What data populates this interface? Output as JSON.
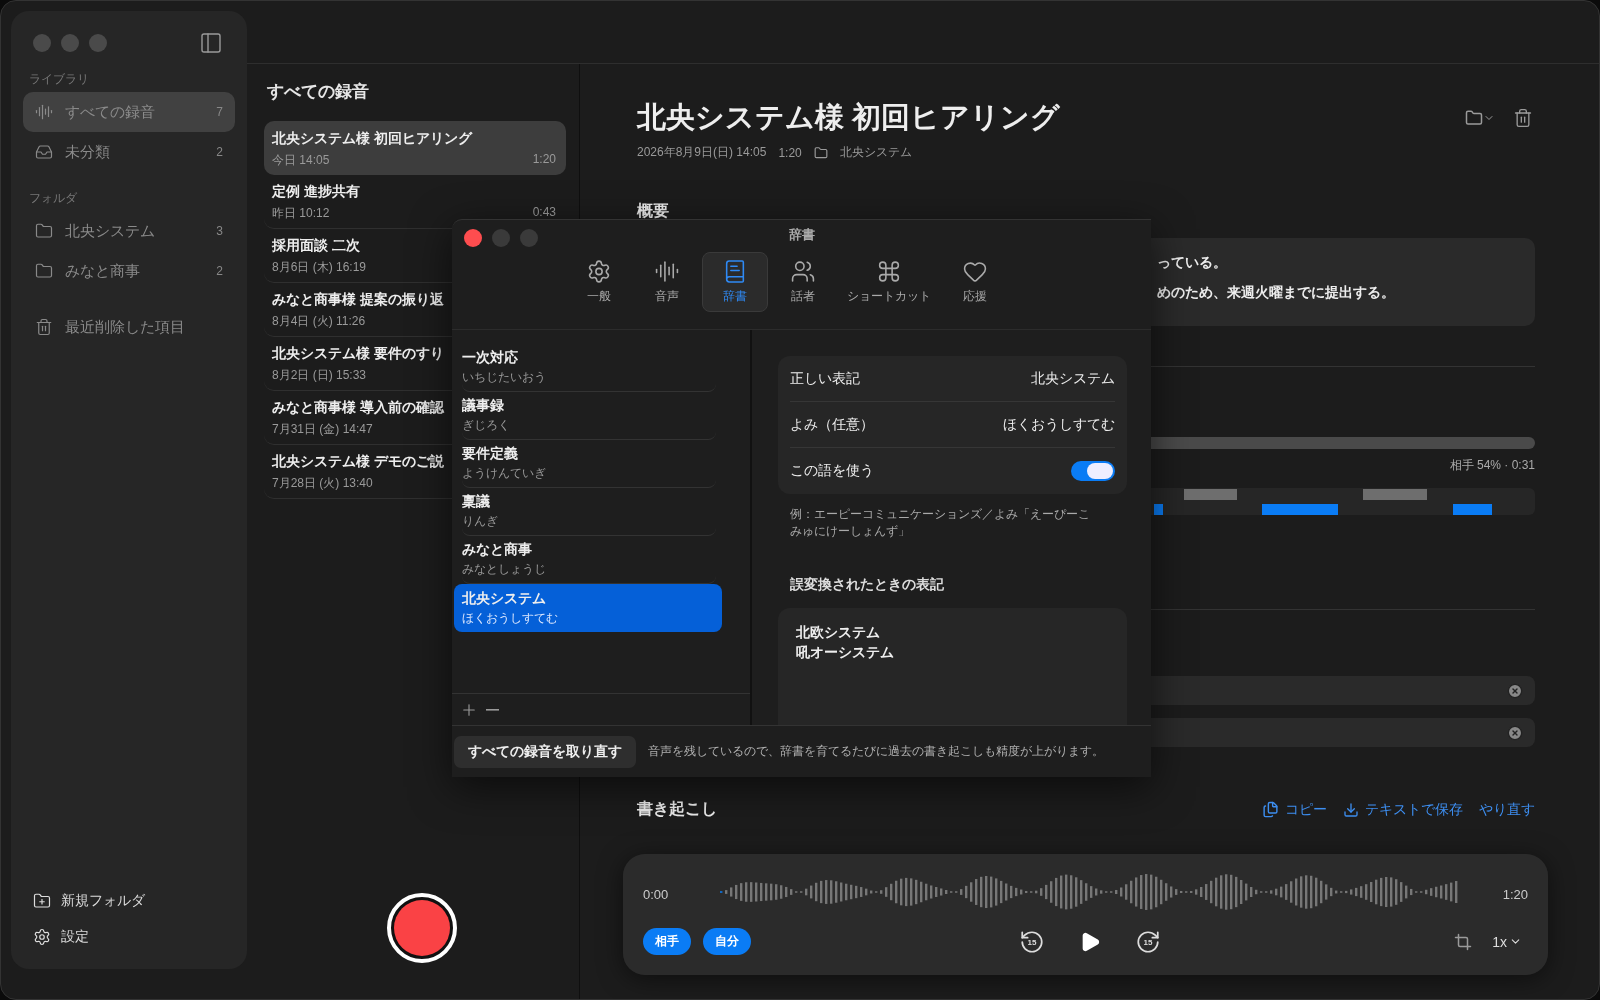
{
  "sidebar": {
    "sections": [
      {
        "heading": "ライブラリ",
        "items": [
          {
            "label": "すべての録音",
            "count": "7",
            "kind": "waveform",
            "selected": true
          },
          {
            "label": "未分類",
            "count": "2",
            "kind": "tray",
            "selected": false
          }
        ]
      },
      {
        "heading": "フォルダ",
        "items": [
          {
            "label": "北央システム",
            "count": "3",
            "kind": "folder",
            "selected": false
          },
          {
            "label": "みなと商事",
            "count": "2",
            "kind": "folder",
            "selected": false
          }
        ]
      }
    ],
    "trash": {
      "label": "最近削除した項目"
    },
    "footer": [
      {
        "label": "新規フォルダ",
        "kind": "new-folder"
      },
      {
        "label": "設定",
        "kind": "settings"
      }
    ]
  },
  "recordings": {
    "title": "すべての録音",
    "items": [
      {
        "title": "北央システム様 初回ヒアリング",
        "date": "今日 14:05",
        "duration": "1:20",
        "selected": true
      },
      {
        "title": "定例 進捗共有",
        "date": "昨日 10:12",
        "duration": "0:43",
        "selected": false
      },
      {
        "title": "採用面談 二次",
        "date": "8月6日 (木) 16:19",
        "selected": false
      },
      {
        "title": "みなと商事様 提案の振り返",
        "date": "8月4日 (火) 11:26",
        "selected": false
      },
      {
        "title": "北央システム様 要件のすり",
        "date": "8月2日 (日) 15:33",
        "selected": false
      },
      {
        "title": "みなと商事様 導入前の確認",
        "date": "7月31日 (金) 14:47",
        "selected": false
      },
      {
        "title": "北央システム様 デモのご説",
        "date": "7月28日 (火) 13:40",
        "selected": false
      }
    ]
  },
  "detail": {
    "title": "北央システム様 初回ヒアリング",
    "date": "2026年8月9日(日) 14:05",
    "duration": "1:20",
    "folder": "北央システム",
    "summary": {
      "heading": "概要",
      "lines": [
        "っている。",
        "めのため、来週火曜までに提出する。"
      ]
    },
    "speaker_share": {
      "reading": "相手 54% · 0:31"
    },
    "transcript": {
      "heading": "書き起こし",
      "actions": [
        {
          "label": "コピー",
          "kind": "copy"
        },
        {
          "label": "テキストで保存",
          "kind": "save"
        },
        {
          "label": "やり直す",
          "kind": "redo"
        }
      ]
    }
  },
  "player": {
    "start": "0:00",
    "end": "1:20",
    "skip_back": "15",
    "skip_forward": "15",
    "speed": "1x",
    "speakers": [
      {
        "label": "相手",
        "on": true
      },
      {
        "label": "自分",
        "on": true
      }
    ]
  },
  "dialog": {
    "title": "辞書",
    "tabs": [
      {
        "label": "一般",
        "kind": "gear",
        "selected": false
      },
      {
        "label": "音声",
        "kind": "waveform",
        "selected": false
      },
      {
        "label": "辞書",
        "kind": "book",
        "selected": true
      },
      {
        "label": "話者",
        "kind": "people",
        "selected": false
      },
      {
        "label": "ショートカット",
        "kind": "command",
        "selected": false
      },
      {
        "label": "応援",
        "kind": "heart",
        "selected": false
      }
    ],
    "words": [
      {
        "word": "一次対応",
        "reading": "いちじたいおう",
        "selected": false
      },
      {
        "word": "議事録",
        "reading": "ぎじろく",
        "selected": false
      },
      {
        "word": "要件定義",
        "reading": "ようけんていぎ",
        "selected": false
      },
      {
        "word": "稟議",
        "reading": "りんぎ",
        "selected": false
      },
      {
        "word": "みなと商事",
        "reading": "みなとしょうじ",
        "selected": false
      },
      {
        "word": "北央システム",
        "reading": "ほくおうしすてむ",
        "selected": true
      }
    ],
    "form": {
      "rows": [
        {
          "label": "正しい表記",
          "value": "北央システム",
          "kind": "text"
        },
        {
          "label": "よみ（任意）",
          "value": "ほくおうしすてむ",
          "kind": "text"
        },
        {
          "label": "この語を使う",
          "kind": "toggle",
          "on": true
        }
      ],
      "hint": "例：エーピーコミュニケーションズ／よみ「えーぴーこみゅにけーしょんず」",
      "misconversions": {
        "heading": "誤変換されたときの表記",
        "lines": [
          "北欧システム",
          "吼オーシステム"
        ]
      }
    },
    "footer": {
      "button": "すべての録音を取り直す",
      "note": "音声を残しているので、辞書を育てるたびに過去の書き起こしも精度が上がります。"
    }
  }
}
